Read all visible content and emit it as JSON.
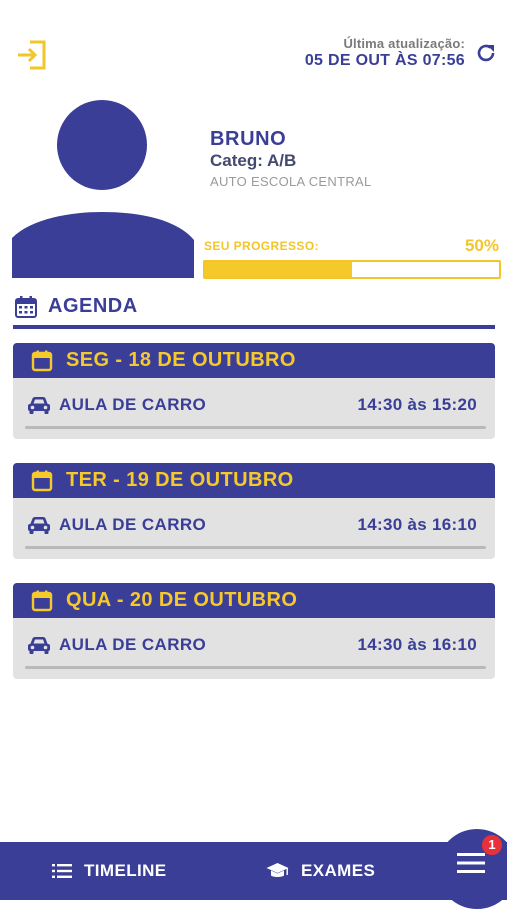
{
  "header": {
    "update_label": "Última atualização:",
    "update_date": "05 DE OUT ÀS 07:56",
    "logout_icon": "logout-icon",
    "refresh_icon": "refresh-icon"
  },
  "profile": {
    "name": "BRUNO",
    "category": "Categ: A/B",
    "school": "AUTO ESCOLA CENTRAL",
    "progress_label": "SEU PROGRESSO:",
    "progress_value": "50%",
    "progress_fraction": 0.5
  },
  "agenda": {
    "title": "AGENDA",
    "items": [
      {
        "date": "SEG - 18 DE OUTUBRO",
        "lesson": "AULA DE CARRO",
        "time": "14:30 às 15:20"
      },
      {
        "date": "TER - 19 DE OUTUBRO",
        "lesson": "AULA DE CARRO",
        "time": "14:30 às 16:10"
      },
      {
        "date": "QUA - 20 DE OUTUBRO",
        "lesson": "AULA DE CARRO",
        "time": "14:30 às 16:10"
      }
    ]
  },
  "nav": {
    "timeline": "TIMELINE",
    "exames": "EXAMES",
    "badge": "1"
  },
  "colors": {
    "primary": "#3a3e96",
    "accent": "#f5c92c",
    "card_bg": "#e2e2e2",
    "badge": "#e8323a"
  }
}
